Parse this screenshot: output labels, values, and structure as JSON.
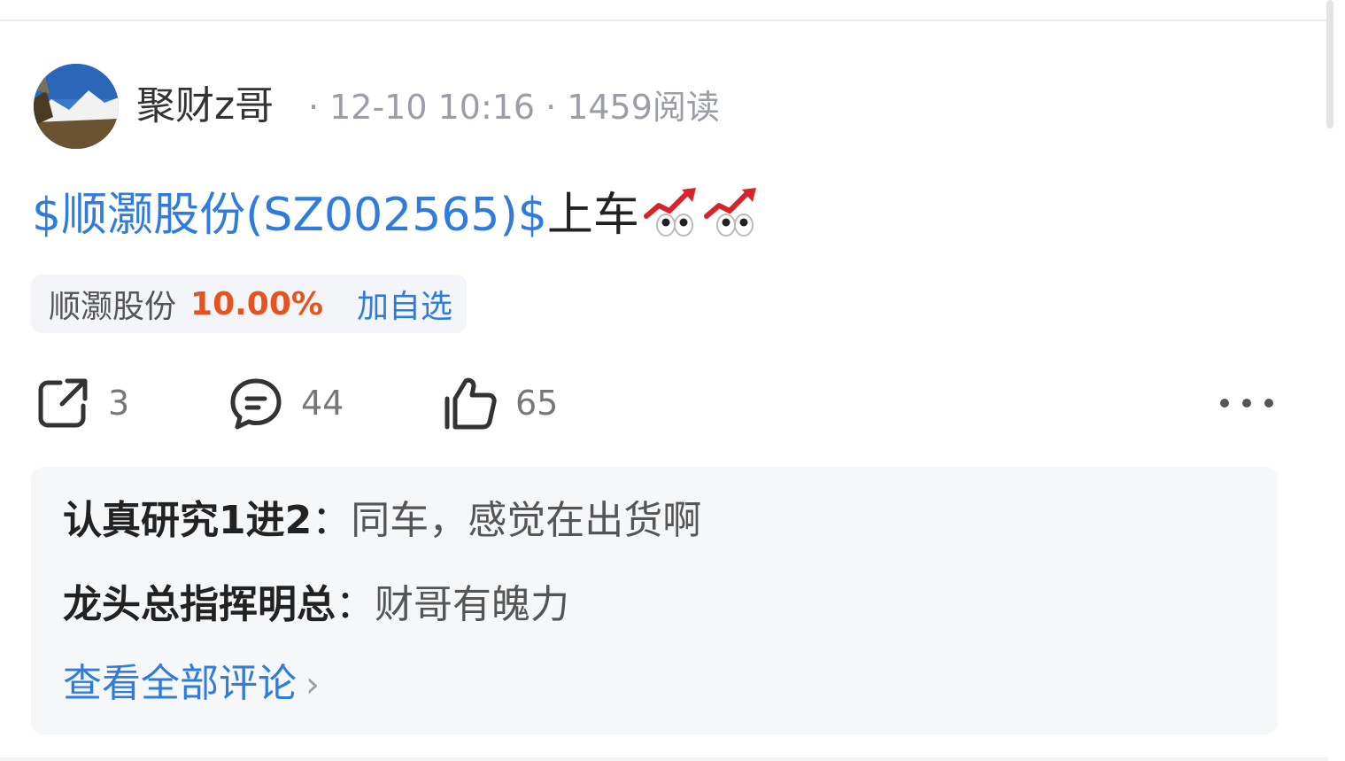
{
  "post": {
    "author": "聚财z哥",
    "time": "12-10 10:16",
    "reads": "1459阅读",
    "separator": "·",
    "stock_link": "$顺灏股份(SZ002565)$",
    "text": "上车",
    "emoji": [
      "chart-rising-eyes-emoji",
      "chart-rising-eyes-emoji"
    ]
  },
  "stock_chip": {
    "name": "顺灏股份",
    "change": "10.00%",
    "add_label": "加自选",
    "change_color": "#e5541e"
  },
  "actions": {
    "share_count": "3",
    "comment_count": "44",
    "like_count": "65"
  },
  "comments": [
    {
      "user": "认真研究1进2",
      "sep": "：",
      "text": "同车，感觉在出货啊"
    },
    {
      "user": "龙头总指挥明总",
      "sep": "：",
      "text": "财哥有魄力"
    }
  ],
  "view_all_label": "查看全部评论",
  "colors": {
    "link": "#2f7cdc",
    "up": "#e5541e"
  }
}
